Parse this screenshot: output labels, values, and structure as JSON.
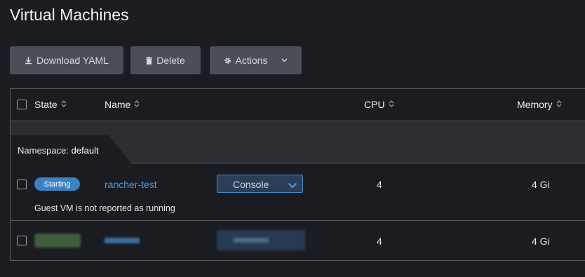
{
  "page": {
    "title": "Virtual Machines"
  },
  "toolbar": {
    "download_label": "Download YAML",
    "delete_label": "Delete",
    "actions_label": "Actions"
  },
  "table": {
    "columns": {
      "state": "State",
      "name": "Name",
      "cpu": "CPU",
      "memory": "Memory"
    },
    "group": {
      "label": "Namespace:",
      "value": "default"
    },
    "rows": [
      {
        "state": "Starting",
        "name": "rancher-test",
        "action": "Console",
        "cpu": "4",
        "memory": "4 Gi",
        "message": "Guest VM is not reported as running"
      },
      {
        "state": "",
        "name": "",
        "action": "",
        "cpu": "4",
        "memory": "4 Gi",
        "redacted": true
      }
    ]
  },
  "colors": {
    "background": "#1b1c21",
    "button": "#4b4e55",
    "accent": "#3c81c4",
    "link": "#4f9be0",
    "group_row": "#2c2d33"
  }
}
